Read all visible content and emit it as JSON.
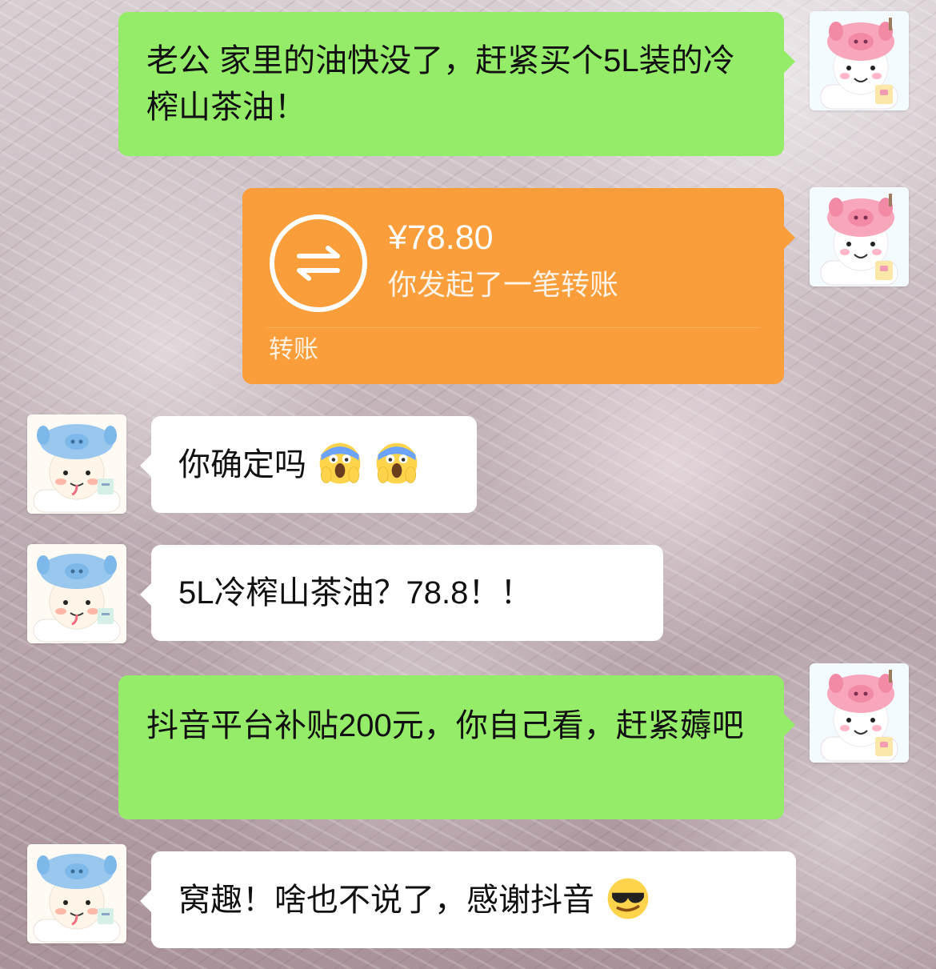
{
  "messages": [
    {
      "text": "老公 家里的油快没了，赶紧买个5L装的冷榨山茶油！"
    },
    {
      "amount": "¥78.80",
      "description": "你发起了一笔转账",
      "footer": "转账"
    },
    {
      "text": "你确定吗",
      "emoji_icons": [
        "scream-emoji-icon",
        "scream-emoji-icon"
      ]
    },
    {
      "text": "5L冷榨山茶油？78.8！！"
    },
    {
      "text": "抖音平台补贴200元，你自己看，赶紧薅吧"
    },
    {
      "text": "窝趣！啥也不说了，感谢抖音",
      "emoji_icon": "sunglasses-emoji-icon"
    }
  ],
  "colors": {
    "sent_bubble": "#95ec69",
    "received_bubble": "#ffffff",
    "transfer_card": "#fa9d3b"
  }
}
